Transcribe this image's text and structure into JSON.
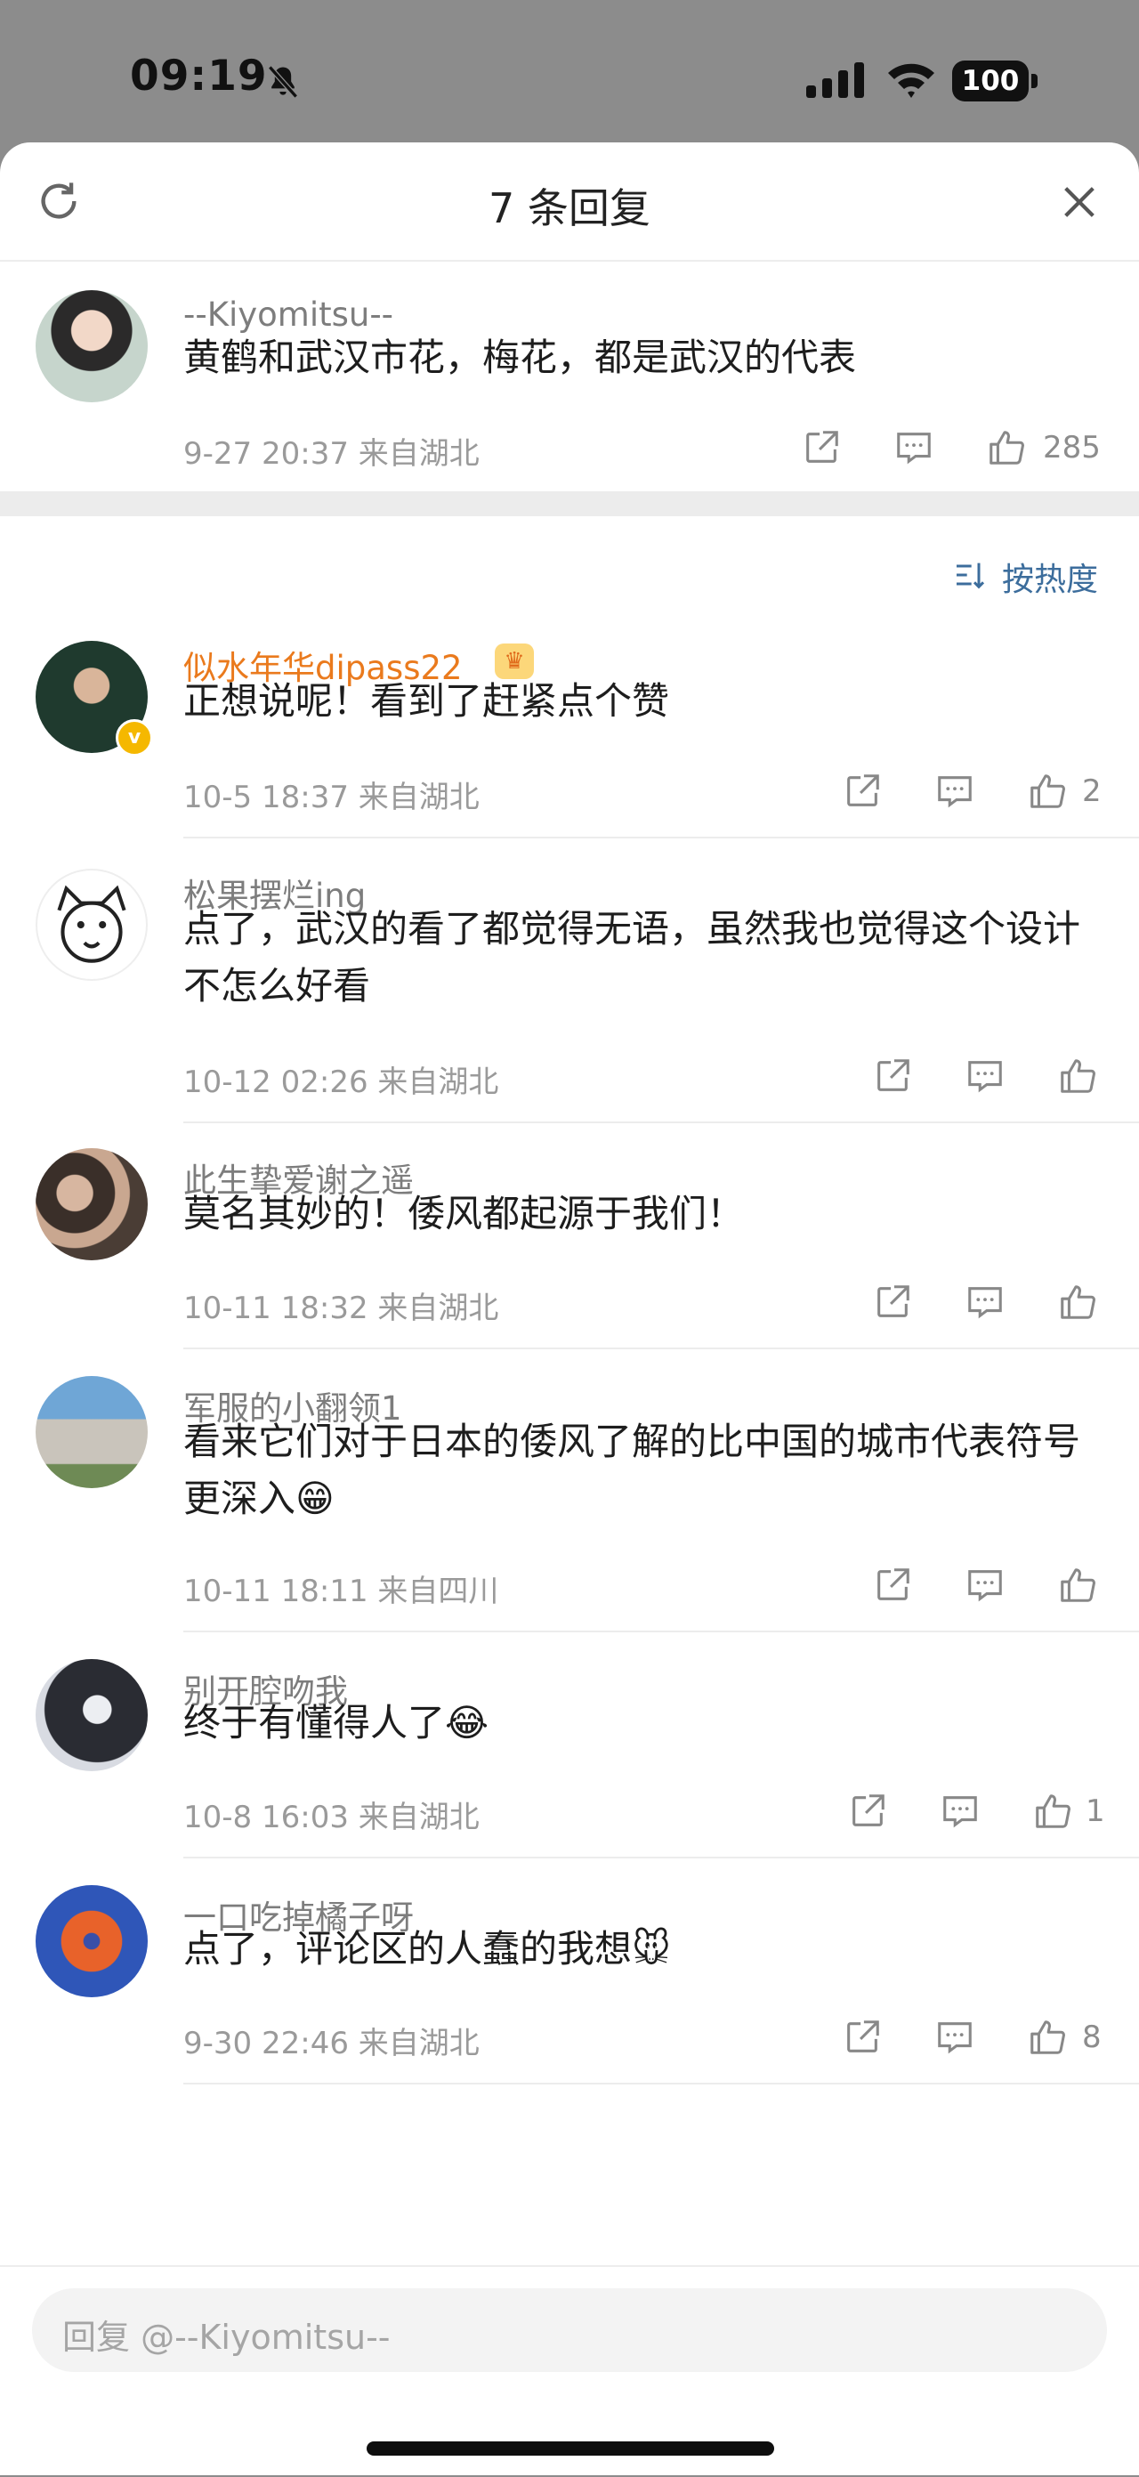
{
  "status_bar": {
    "time": "09:19",
    "battery": "100"
  },
  "header": {
    "title": "7 条回复"
  },
  "sort_label": "按热度",
  "root_comment": {
    "username": "--Kiyomitsu--",
    "content": "黄鹤和武汉市花，梅花，都是武汉的代表",
    "meta": "9-27 20:37  来自湖北",
    "likes": "285"
  },
  "replies": [
    {
      "username": "似水年华dipass22",
      "content": "正想说呢！看到了赶紧点个赞",
      "meta": "10-5 18:37  来自湖北",
      "likes": "2"
    },
    {
      "username": "松果摆烂ing",
      "content": "点了，武汉的看了都觉得无语，虽然我也觉得这个设计不怎么好看",
      "meta": "10-12 02:26  来自湖北",
      "likes": ""
    },
    {
      "username": "此生挚爱谢之遥",
      "content": "莫名其妙的！倭风都起源于我们！",
      "meta": "10-11 18:32  来自湖北",
      "likes": ""
    },
    {
      "username": "军服的小翻领1",
      "content": "看来它们对于日本的倭风了解的比中国的城市代表符号更深入😁",
      "meta": "10-11 18:11  来自四川",
      "likes": ""
    },
    {
      "username": "别开腔吻我",
      "content": "终于有懂得人了😂",
      "meta": "10-8 16:03  来自湖北",
      "likes": "1"
    },
    {
      "username": "一口吃掉橘子呀",
      "content": "点了，评论区的人蠢的我想🐭",
      "meta": "9-30 22:46  来自湖北",
      "likes": "8"
    }
  ],
  "reply_input": {
    "placeholder": "回复 @--Kiyomitsu--"
  },
  "colors": {
    "accent_blue": "#3c6d9c",
    "username_orange": "#ea7a1d",
    "meta_gray": "#9a9a9a"
  }
}
